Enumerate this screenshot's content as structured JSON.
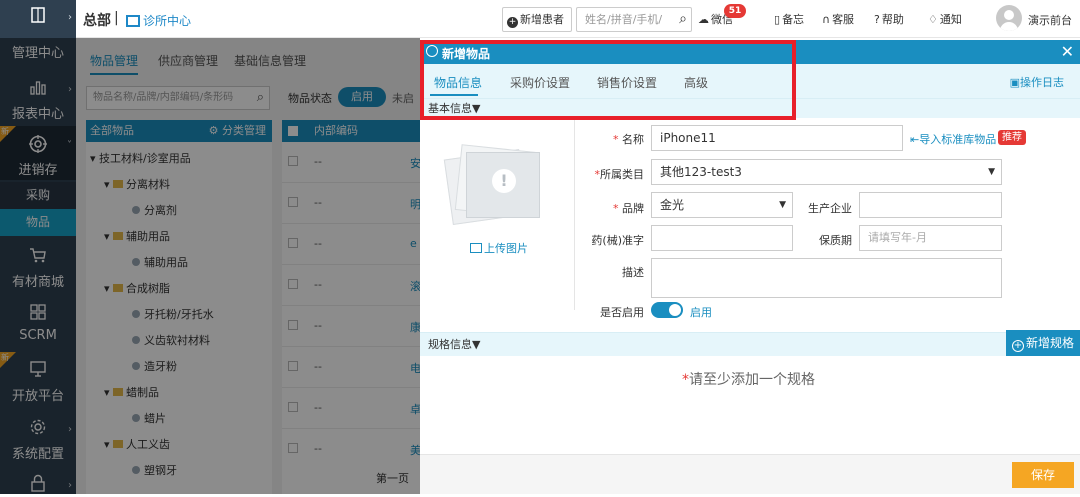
{
  "sidebar": {
    "items": [
      {
        "label": "",
        "icon": "book-icon"
      },
      {
        "label": "管理中心",
        "icon": "book-icon"
      },
      {
        "label": "报表中心",
        "icon": "bar-chart-icon"
      },
      {
        "label": "进销存",
        "icon": "target-icon",
        "badge": "新"
      },
      {
        "label": "有材商城",
        "icon": "cart-icon"
      },
      {
        "label": "SCRM",
        "icon": "grid-icon"
      },
      {
        "label": "开放平台",
        "icon": "monitor-icon",
        "badge": "新"
      },
      {
        "label": "系统配置",
        "icon": "gear-icon"
      },
      {
        "label": "",
        "icon": "lock-icon"
      }
    ],
    "sub_items": [
      {
        "label": "采购"
      },
      {
        "label": "物品"
      }
    ]
  },
  "topbar": {
    "brand": "总部",
    "separator": "|",
    "clinic": "诊所中心",
    "new_patient": "新增患者",
    "search_placeholder": "姓名/拼音/手机/",
    "wechat": "微信",
    "wechat_count": "51",
    "memo": "备忘",
    "service": "客服",
    "help": "帮助",
    "notify": "通知",
    "user": "演示前台"
  },
  "background": {
    "tabs": [
      "物品管理",
      "供应商管理",
      "基础信息管理"
    ],
    "search_placeholder": "物品名称/品牌/内部编码/条形码",
    "status_label": "物品状态",
    "status_value": "启用",
    "status_more": "未启",
    "tree_header": "全部物品",
    "tree_manage": "分类管理",
    "tree": [
      {
        "label": "技工材料/诊室用品",
        "level": 0
      },
      {
        "label": "分离材料",
        "level": 1
      },
      {
        "label": "分离剂",
        "level": 2
      },
      {
        "label": "辅助用品",
        "level": 1
      },
      {
        "label": "辅助用品",
        "level": 2
      },
      {
        "label": "合成树脂",
        "level": 1
      },
      {
        "label": "牙托粉/牙托水",
        "level": 2
      },
      {
        "label": "义齿软衬材料",
        "level": 2
      },
      {
        "label": "造牙粉",
        "level": 2
      },
      {
        "label": "蜡制品",
        "level": 1
      },
      {
        "label": "蜡片",
        "level": 2
      },
      {
        "label": "人工义齿",
        "level": 1
      },
      {
        "label": "塑钢牙",
        "level": 2
      }
    ],
    "grid_header": "内部编码",
    "grid_header_more": "",
    "grid_rows": [
      {
        "code": "--",
        "tail": "安"
      },
      {
        "code": "--",
        "tail": "明"
      },
      {
        "code": "--",
        "tail": "e"
      },
      {
        "code": "--",
        "tail": "滚"
      },
      {
        "code": "--",
        "tail": "康"
      },
      {
        "code": "--",
        "tail": "电"
      },
      {
        "code": "--",
        "tail": "卓"
      },
      {
        "code": "--",
        "tail": "美"
      }
    ],
    "pager": "第一页"
  },
  "modal": {
    "title": "新增物品",
    "tabs": [
      "物品信息",
      "采购价设置",
      "销售价设置",
      "高级"
    ],
    "oplog": "操作日志",
    "basic_section": "基本信息▼",
    "upload": "上传图片",
    "fields": {
      "name_label": "名称",
      "name_value": "iPhone11",
      "category_label": "所属类目",
      "category_value": "其他123-test3",
      "brand_label": "品牌",
      "brand_value": "金光",
      "maker_label": "生产企业",
      "maker_value": "",
      "approval_label": "药(械)准字",
      "approval_value": "",
      "shelf_label": "保质期",
      "shelf_placeholder": "请填写年-月",
      "desc_label": "描述",
      "desc_value": "",
      "enabled_label": "是否启用",
      "enabled_value": "启用"
    },
    "import_link": "导入标准库物品",
    "recommend": "推荐",
    "spec_section": "规格信息▼",
    "add_spec": "新增规格",
    "empty_required": "*",
    "empty_text": "请至少添加一个规格",
    "save": "保存"
  },
  "colors": {
    "accent": "#1a8ec0",
    "sidebar": "#2f4050",
    "highlight": "#e8202a",
    "save": "#f5a623"
  }
}
